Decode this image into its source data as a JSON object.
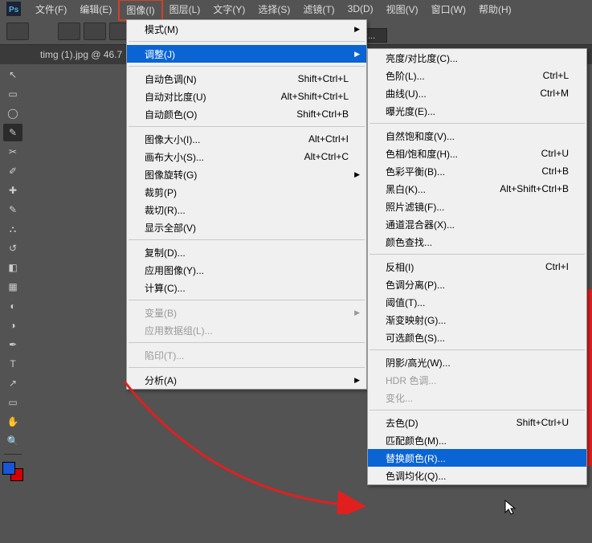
{
  "logo_text": "Ps",
  "menubar": {
    "file": "文件(F)",
    "edit": "编辑(E)",
    "image": "图像(I)",
    "layer": "图层(L)",
    "type": "文字(Y)",
    "select": "选择(S)",
    "filter": "滤镜(T)",
    "threeD": "3D(D)",
    "view": "视图(V)",
    "window": "窗口(W)",
    "help": "帮助(H)"
  },
  "tab": {
    "label": "timg (1).jpg @ 46.7"
  },
  "optbar": {
    "edge": "缘..."
  },
  "menu1": {
    "mode": "模式(M)",
    "adjust": "调整(J)",
    "autoTone": "自动色调(N)",
    "autoTone_sc": "Shift+Ctrl+L",
    "autoContrast": "自动对比度(U)",
    "autoContrast_sc": "Alt+Shift+Ctrl+L",
    "autoColor": "自动颜色(O)",
    "autoColor_sc": "Shift+Ctrl+B",
    "imageSize": "图像大小(I)...",
    "imageSize_sc": "Alt+Ctrl+I",
    "canvasSize": "画布大小(S)...",
    "canvasSize_sc": "Alt+Ctrl+C",
    "imageRot": "图像旋转(G)",
    "crop": "裁剪(P)",
    "trim": "裁切(R)...",
    "revealAll": "显示全部(V)",
    "duplicate": "复制(D)...",
    "applyImage": "应用图像(Y)...",
    "calc": "计算(C)...",
    "variables": "变量(B)",
    "applyData": "应用数据组(L)...",
    "trap": "陷印(T)...",
    "analysis": "分析(A)"
  },
  "menu2": {
    "brightContrast": "亮度/对比度(C)...",
    "levels": "色阶(L)...",
    "levels_sc": "Ctrl+L",
    "curves": "曲线(U)...",
    "curves_sc": "Ctrl+M",
    "exposure": "曝光度(E)...",
    "vibrance": "自然饱和度(V)...",
    "hueSat": "色相/饱和度(H)...",
    "hueSat_sc": "Ctrl+U",
    "colorBal": "色彩平衡(B)...",
    "colorBal_sc": "Ctrl+B",
    "bw": "黑白(K)...",
    "bw_sc": "Alt+Shift+Ctrl+B",
    "photoFilter": "照片滤镜(F)...",
    "chanMixer": "通道混合器(X)...",
    "colorLookup": "颜色查找...",
    "invert": "反相(I)",
    "invert_sc": "Ctrl+I",
    "posterize": "色调分离(P)...",
    "threshold": "阈值(T)...",
    "gradMap": "渐变映射(G)...",
    "selColor": "可选颜色(S)...",
    "shadowHL": "阴影/高光(W)...",
    "hdr": "HDR 色调...",
    "variations": "变化...",
    "desat": "去色(D)",
    "desat_sc": "Shift+Ctrl+U",
    "matchColor": "匹配颜色(M)...",
    "replaceColor": "替换颜色(R)...",
    "equalize": "色调均化(Q)..."
  }
}
